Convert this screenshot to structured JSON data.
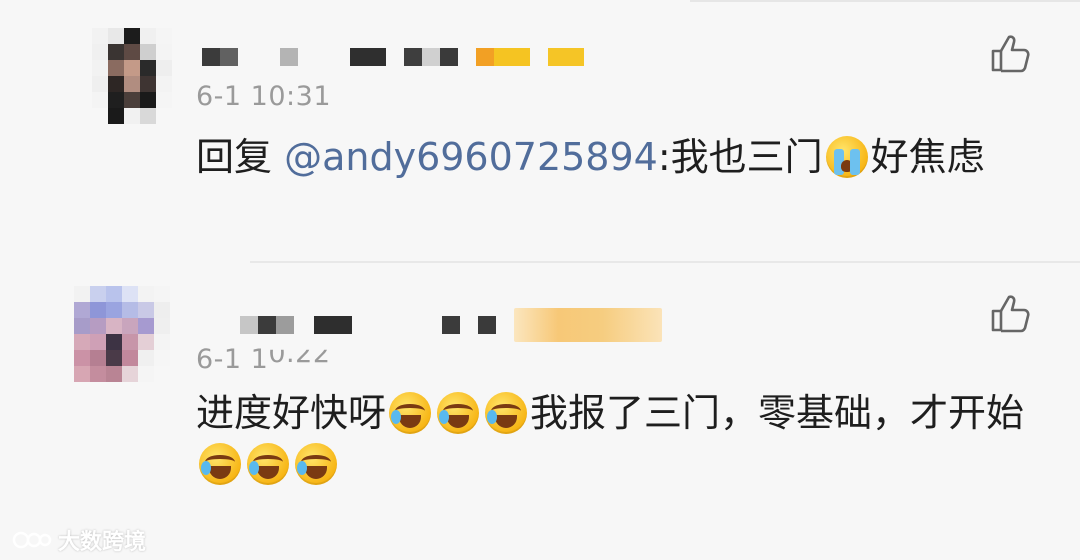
{
  "comments": [
    {
      "time_prefix": "6-1 10:31",
      "reply_prefix": "回复 ",
      "mention": "@andy6960725894",
      "text_part1": ":我也三门",
      "emoji1": "crying-face-icon",
      "text_part2": "好焦虑"
    },
    {
      "time_prefix": "6-1 1",
      "time_garbled": "0.22",
      "text_part1": "进度好快呀",
      "emoji_group1": [
        "laughing-tears-icon",
        "laughing-tears-icon",
        "laughing-tears-icon"
      ],
      "text_part2": "我报了三门，零基础，才开始",
      "emoji_group2": [
        "laughing-tears-icon",
        "laughing-tears-icon",
        "laughing-tears-icon"
      ]
    }
  ],
  "watermark": "大数跨境",
  "colors": {
    "background": "#f7f7f7",
    "mention": "#516d9b",
    "timestamp": "#9a9a9a",
    "text": "#1e1e1e"
  }
}
